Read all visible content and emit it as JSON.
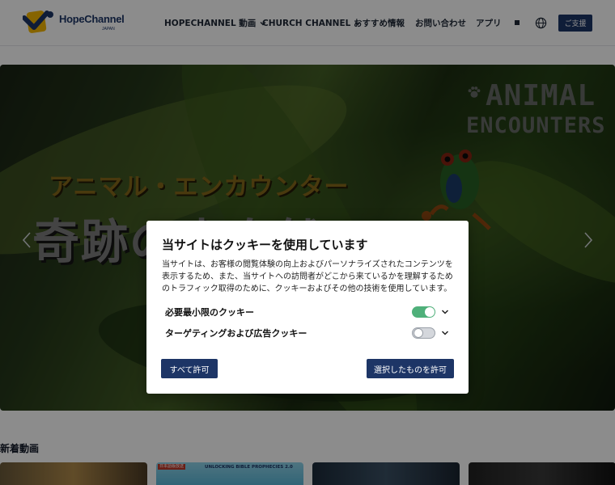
{
  "header": {
    "logo_text": "HopeChannel",
    "logo_sub": "JAPAN",
    "nav": [
      {
        "label": "HOPECHANNEL 動画"
      },
      {
        "label": "CHURCH CHANNEL"
      },
      {
        "label": "おすすめ情報"
      },
      {
        "label": "お問い合わせ"
      },
      {
        "label": "アプリ"
      }
    ],
    "support_label": "ご支援"
  },
  "hero": {
    "subtitle": "アニマル・エンカウンター",
    "title": "奇跡の大自然",
    "brand_line1": "ANIMAL",
    "brand_line2": "ENCOUNTERS"
  },
  "section": {
    "title": "新着動画",
    "thumb2_badge": "日本語版放送",
    "thumb2_title": "UNLOCKING BIBLE PROPHECIES 2.0"
  },
  "cookie_modal": {
    "title": "当サイトはクッキーを使用しています",
    "body": "当サイトは、お客様の閲覧体験の向上およびパーソナライズされたコンテンツを表示するため、また、当サイトへの訪問者がどこから来ているかを理解するためのトラフィック取得のために、クッキーおよびその他の技術を使用しています。",
    "options": [
      {
        "label": "必要最小限のクッキー",
        "enabled": true
      },
      {
        "label": "ターゲティングおよび広告クッキー",
        "enabled": false
      }
    ],
    "allow_all_label": "すべて許可",
    "allow_selected_label": "選択したものを許可"
  },
  "colors": {
    "brand_navy": "#1d3566",
    "toggle_on": "#4fb07a",
    "logo_yellow": "#f5b700"
  }
}
